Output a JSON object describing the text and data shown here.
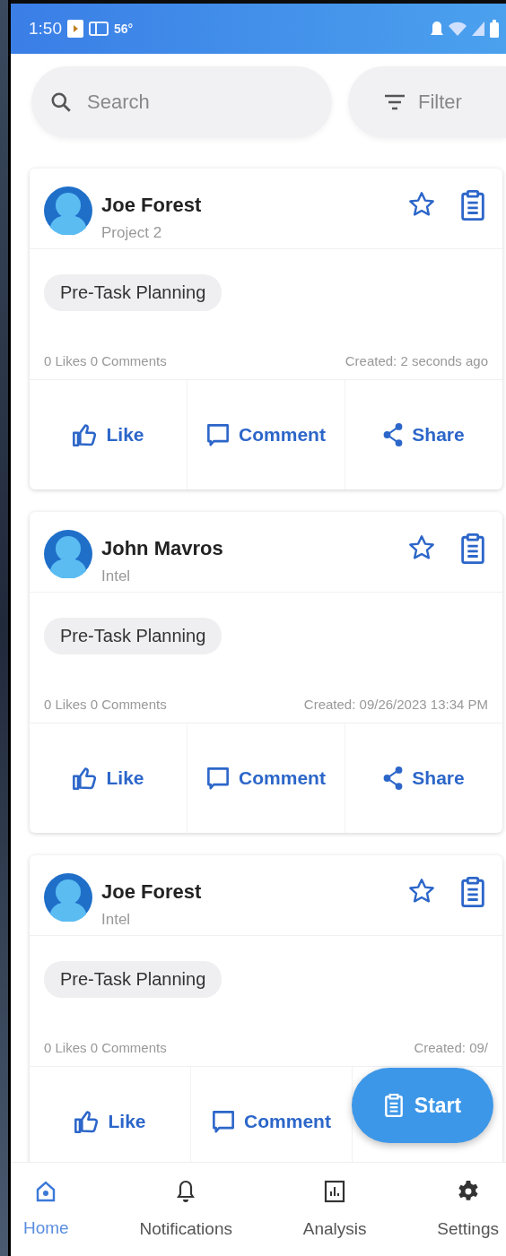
{
  "status_bar": {
    "time": "1:50",
    "temperature": "56°"
  },
  "search": {
    "placeholder": "Search"
  },
  "filter_button": {
    "label": "Filter"
  },
  "posts": [
    {
      "author": "Joe Forest",
      "project": "Project 2",
      "tag": "Pre-Task Planning",
      "stats": "0 Likes 0 Comments",
      "created": "Created: 2 seconds ago",
      "starred": false,
      "actions": [
        "Like",
        "Comment",
        "Share"
      ]
    },
    {
      "author": "John Mavros",
      "project": "Intel",
      "tag": "Pre-Task Planning",
      "stats": "0 Likes 0 Comments",
      "created": "Created: 09/26/2023 13:34 PM",
      "starred": false,
      "actions": [
        "Like",
        "Comment",
        "Share"
      ]
    },
    {
      "author": "Joe Forest",
      "project": "Intel",
      "tag": "Pre-Task Planning",
      "stats": "0 Likes 0 Comments",
      "created": "Created: 09/",
      "starred": false,
      "actions": [
        "Like",
        "Comment"
      ]
    }
  ],
  "fab": {
    "label": "Start"
  },
  "nav": [
    {
      "label": "Home",
      "selected": true
    },
    {
      "label": "Notifications",
      "selected": false
    },
    {
      "label": "Analysis",
      "selected": false
    },
    {
      "label": "Settings",
      "selected": false
    }
  ]
}
